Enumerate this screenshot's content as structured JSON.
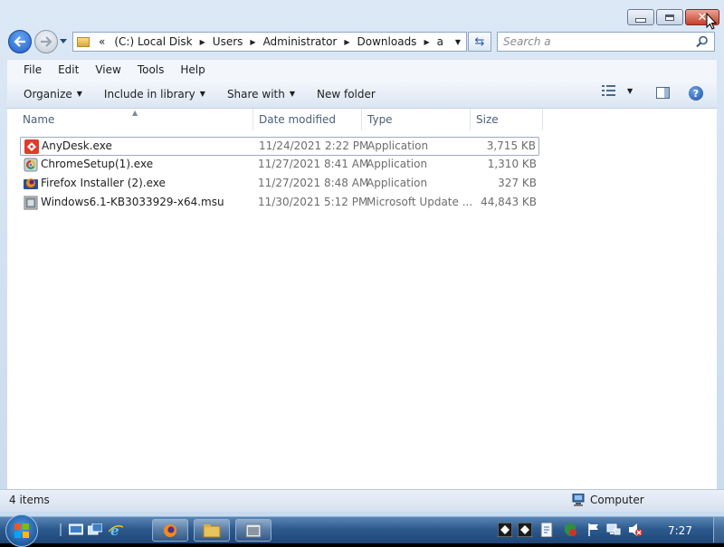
{
  "window": {
    "address_path": [
      "(C:) Local Disk",
      "Users",
      "Administrator",
      "Downloads",
      "a"
    ],
    "address_overflow": "«",
    "search_placeholder": "Search a"
  },
  "menu": [
    "File",
    "Edit",
    "View",
    "Tools",
    "Help"
  ],
  "commands": {
    "organize": "Organize",
    "include_in_library": "Include in library",
    "share_with": "Share with",
    "new_folder": "New folder"
  },
  "columns": {
    "name": "Name",
    "date_modified": "Date modified",
    "type": "Type",
    "size": "Size"
  },
  "files": [
    {
      "name": "AnyDesk.exe",
      "date": "11/24/2021 2:22 PM",
      "type": "Application",
      "size": "3,715 KB",
      "icon": "anydesk-icon",
      "selected": true
    },
    {
      "name": "ChromeSetup(1).exe",
      "date": "11/27/2021 8:41 AM",
      "type": "Application",
      "size": "1,310 KB",
      "icon": "chrome-setup-icon",
      "selected": false
    },
    {
      "name": "Firefox Installer (2).exe",
      "date": "11/27/2021 8:48 AM",
      "type": "Application",
      "size": "327 KB",
      "icon": "firefox-installer-icon",
      "selected": false
    },
    {
      "name": "Windows6.1-KB3033929-x64.msu",
      "date": "11/30/2021 5:12 PM",
      "type": "Microsoft Update ...",
      "size": "44,843 KB",
      "icon": "msu-package-icon",
      "selected": false
    }
  ],
  "status": {
    "item_count": "4 items",
    "location": "Computer"
  },
  "taskbar": {
    "clock": "7:27"
  },
  "colors": {
    "window_frame": "#c9dbee",
    "taskbar": "#2d5a8e",
    "close_button": "#c5402b",
    "anydesk_red": "#e03a2b"
  }
}
